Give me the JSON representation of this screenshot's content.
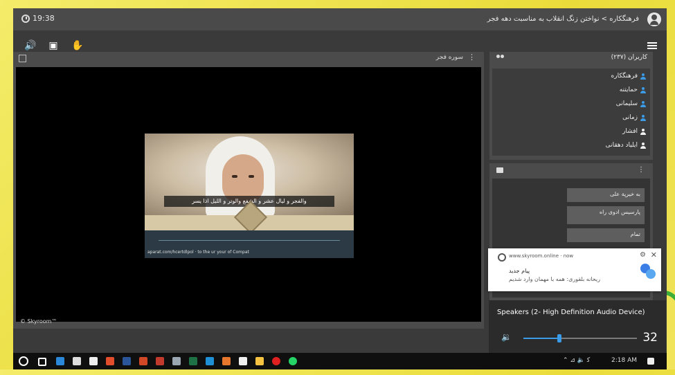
{
  "topbar": {
    "time": "19:38",
    "breadcrumb": "فرهنگکاره > نواختن زنگ انقلاب به مناسبت دهه فجر"
  },
  "video_panel": {
    "title": "سوره فجر",
    "subtitle": "والفجر و لیال عشر و الشفع والوتر و اللیل اذا یسر",
    "url_text": "aparat.com/hcertdlpol · to the ur your of Compat",
    "copyright": "© Skyroom™"
  },
  "participants": {
    "title": "کاربران (۲۳۷)",
    "users": [
      {
        "name": "فرهنگکاره",
        "role": "admin"
      },
      {
        "name": "حمایتنه",
        "role": "admin"
      },
      {
        "name": "سلیمانی",
        "role": "admin"
      },
      {
        "name": "زمانی",
        "role": "admin"
      },
      {
        "name": "افشار",
        "role": "guest"
      },
      {
        "name": "ایلیاد دهقانی",
        "role": "guest"
      }
    ]
  },
  "chat": {
    "messages": [
      "به خیرپة علی",
      "پارسیس ادوی راه",
      "تمام"
    ]
  },
  "notification": {
    "site": "www.skyroom.online · now",
    "title": "پیام جدید",
    "message": "ریحانه بلقوری: همه با مهمان وارد شدیم"
  },
  "volume": {
    "device": "Speakers (2- High Definition Audio Device)",
    "level": 32
  },
  "taskbar": {
    "time": "2:18 AM"
  },
  "colors": {
    "accent": "#3b9be6",
    "panel": "#4b4b4b",
    "background": "#f0e85a"
  }
}
